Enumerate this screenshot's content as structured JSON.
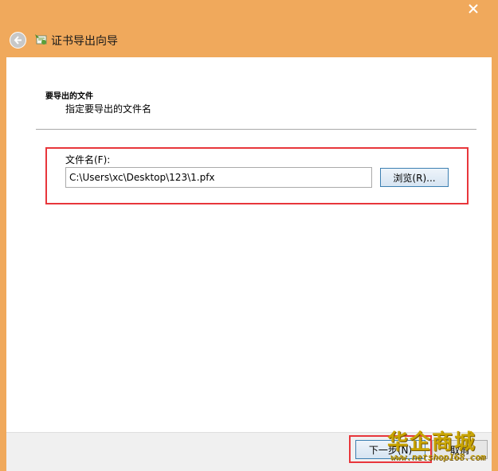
{
  "window": {
    "close_icon": "close-icon",
    "background_color": "#f0a95c"
  },
  "header": {
    "back_icon": "back-arrow-icon",
    "app_icon": "certificate-wizard-icon",
    "title": "证书导出向导"
  },
  "section": {
    "title": "要导出的文件",
    "subtitle": "指定要导出的文件名"
  },
  "file": {
    "label": "文件名(F):",
    "value": "C:\\Users\\xc\\Desktop\\123\\1.pfx",
    "browse_label": "浏览(R)..."
  },
  "footer": {
    "next_label": "下一步(N)",
    "cancel_label": "取消"
  },
  "highlight_color": "#e8363b",
  "watermark": {
    "title": "华企商城",
    "url": "www.netshop168.com"
  }
}
